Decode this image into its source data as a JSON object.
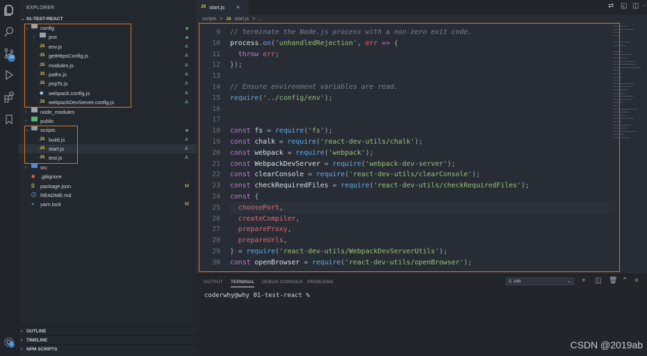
{
  "sidebar": {
    "title": "EXPLORER",
    "root": "01-TEST-REACT",
    "items": [
      {
        "label": "config",
        "kind": "folder",
        "open": true,
        "depth": 1,
        "status": "dot"
      },
      {
        "label": "jest",
        "kind": "folder",
        "open": false,
        "depth": 2,
        "status": "dot"
      },
      {
        "label": "env.js",
        "kind": "js",
        "depth": 2,
        "status": "A"
      },
      {
        "label": "getHttpsConfig.js",
        "kind": "js",
        "depth": 2,
        "status": "A"
      },
      {
        "label": "modules.js",
        "kind": "js",
        "depth": 2,
        "status": "A"
      },
      {
        "label": "paths.js",
        "kind": "js",
        "depth": 2,
        "status": "A"
      },
      {
        "label": "pnpTs.js",
        "kind": "js",
        "depth": 2,
        "status": "A"
      },
      {
        "label": "webpack.config.js",
        "kind": "webpack",
        "depth": 2,
        "status": "A"
      },
      {
        "label": "webpackDevServer.config.js",
        "kind": "js",
        "depth": 2,
        "status": "A"
      },
      {
        "label": "node_modules",
        "kind": "folder",
        "open": false,
        "depth": 1,
        "status": ""
      },
      {
        "label": "public",
        "kind": "folder",
        "open": false,
        "depth": 1,
        "status": ""
      },
      {
        "label": "scripts",
        "kind": "folder",
        "open": true,
        "depth": 1,
        "status": "dot"
      },
      {
        "label": "build.js",
        "kind": "js",
        "depth": 2,
        "status": "A"
      },
      {
        "label": "start.js",
        "kind": "js",
        "depth": 2,
        "status": "A"
      },
      {
        "label": "test.js",
        "kind": "js",
        "depth": 2,
        "status": "A"
      },
      {
        "label": "src",
        "kind": "folder",
        "open": false,
        "depth": 1,
        "status": ""
      },
      {
        "label": ".gitignore",
        "kind": "git",
        "depth": 1,
        "status": ""
      },
      {
        "label": "package.json",
        "kind": "json",
        "depth": 1,
        "status": "M"
      },
      {
        "label": "README.md",
        "kind": "info",
        "depth": 1,
        "status": ""
      },
      {
        "label": "yarn.lock",
        "kind": "yarn",
        "depth": 1,
        "status": "M"
      }
    ],
    "sections": [
      "OUTLINE",
      "TIMELINE",
      "NPM SCRIPTS"
    ]
  },
  "activity": {
    "icons": [
      "files-icon",
      "search-icon",
      "source-control-icon",
      "run-debug-icon",
      "extensions-icon",
      "bookmark-icon"
    ],
    "scm_badge": "14",
    "settings_badge": "1"
  },
  "editor": {
    "tab": {
      "icon": "JS",
      "label": "start.js",
      "close": "×"
    },
    "breadcrumb": [
      "scripts",
      ">",
      "JS",
      "start.js",
      ">",
      "..."
    ],
    "lines": [
      {
        "n": "9",
        "text": "// terminate the Node.js process with a non-zero exit code."
      },
      {
        "n": "10",
        "text": "process.on('unhandledRejection', err => {"
      },
      {
        "n": "11",
        "text": "  throw err;"
      },
      {
        "n": "12",
        "text": "});"
      },
      {
        "n": "13",
        "text": ""
      },
      {
        "n": "14",
        "text": "// Ensure environment variables are read."
      },
      {
        "n": "15",
        "text": "require('../config/env');"
      },
      {
        "n": "16",
        "text": ""
      },
      {
        "n": "17",
        "text": ""
      },
      {
        "n": "18",
        "text": "const fs = require('fs');"
      },
      {
        "n": "19",
        "text": "const chalk = require('react-dev-utils/chalk');"
      },
      {
        "n": "20",
        "text": "const webpack = require('webpack');"
      },
      {
        "n": "21",
        "text": "const WebpackDevServer = require('webpack-dev-server');"
      },
      {
        "n": "22",
        "text": "const clearConsole = require('react-dev-utils/clearConsole');"
      },
      {
        "n": "23",
        "text": "const checkRequiredFiles = require('react-dev-utils/checkRequiredFiles');"
      },
      {
        "n": "24",
        "text": "const {"
      },
      {
        "n": "25",
        "text": "  choosePort,"
      },
      {
        "n": "26",
        "text": "  createCompiler,"
      },
      {
        "n": "27",
        "text": "  prepareProxy,"
      },
      {
        "n": "28",
        "text": "  prepareUrls,"
      },
      {
        "n": "29",
        "text": "} = require('react-dev-utils/WebpackDevServerUtils');"
      },
      {
        "n": "30",
        "text": "const openBrowser = require('react-dev-utils/openBrowser');"
      }
    ]
  },
  "panel": {
    "tabs": [
      "OUTPUT",
      "TERMINAL",
      "DEBUG CONSOLE",
      "PROBLEMS"
    ],
    "active_tab": "TERMINAL",
    "terminal_select": "1: zsh",
    "prompt": "coderwhy@why 01-test-react %"
  },
  "watermark": "CSDN @2019ab",
  "colors": {
    "highlight_box": "#e3791f",
    "accent": "#3b82c4"
  }
}
